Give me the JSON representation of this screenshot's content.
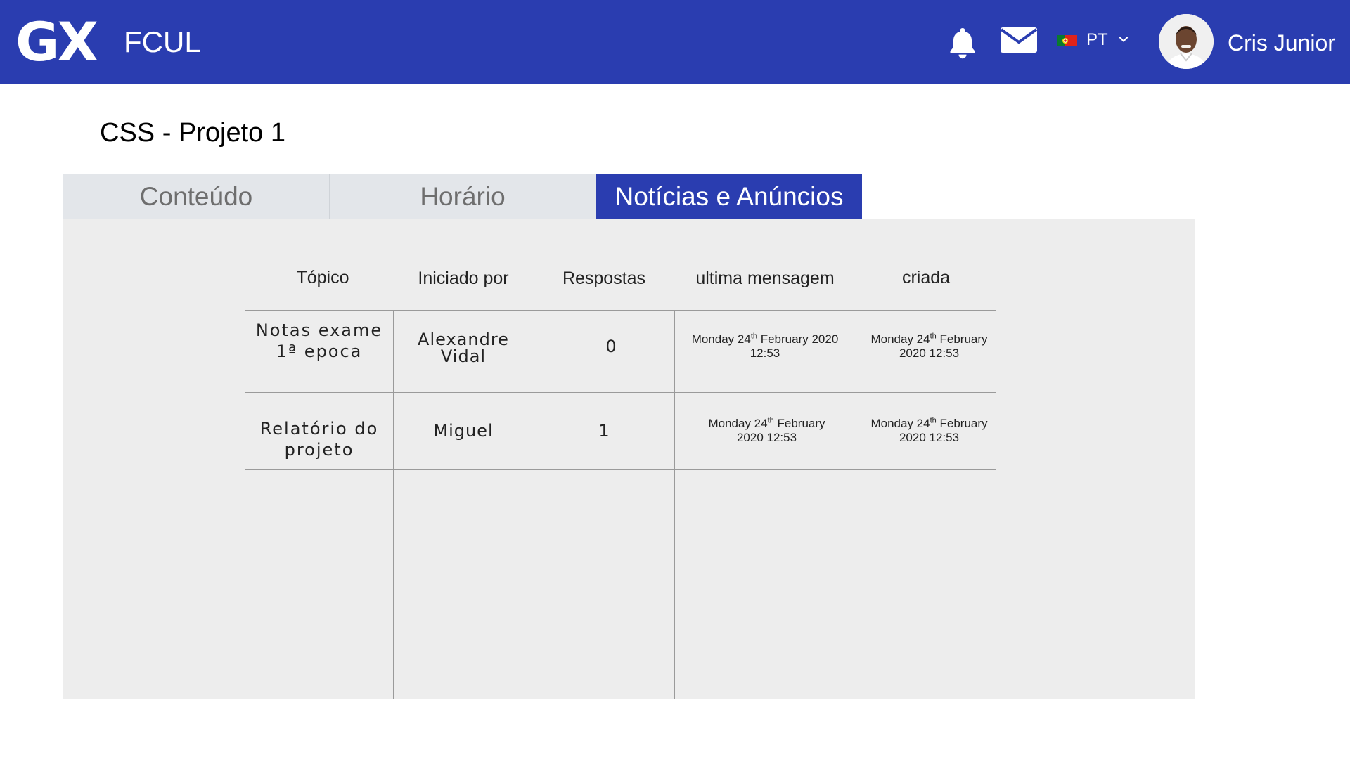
{
  "header": {
    "logo": "GX",
    "app_name": "FCUL",
    "language": "PT",
    "user_name": "Cris Junior",
    "bg_color": "#2a3db0"
  },
  "icons": {
    "bell": "bell-icon",
    "mail": "mail-icon",
    "flag": "portugal-flag-icon",
    "chevron": "chevron-down-icon",
    "avatar": "user-avatar"
  },
  "page": {
    "title": "CSS - Projeto 1"
  },
  "tabs": [
    {
      "label": "Conteúdo",
      "active": false
    },
    {
      "label": "Horário",
      "active": false
    },
    {
      "label": "Notícias e Anúncios",
      "active": true
    }
  ],
  "table": {
    "headers": [
      "Tópico",
      "Iniciado por",
      "Respostas",
      "ultima mensagem",
      "criada"
    ],
    "rows": [
      {
        "topic_line1": "Notas exame",
        "topic_line2": "1ª epoca",
        "author_line1": "Alexandre",
        "author_line2": "Vidal",
        "replies": "0",
        "last_day": "Monday 24",
        "last_suffix": "th",
        "last_rest1": " February 2020",
        "last_rest2": "12:53",
        "created_day": "Monday 24",
        "created_suffix": "th",
        "created_rest1": " February",
        "created_rest2": "2020 12:53"
      },
      {
        "topic_line1": "Relatório do",
        "topic_line2": "projeto",
        "author_line1": "Miguel",
        "replies": "1",
        "last_day": "Monday 24",
        "last_suffix": "th",
        "last_rest1": " February",
        "last_rest2": "2020 12:53",
        "created_day": "Monday 24",
        "created_suffix": "th",
        "created_rest1": " February",
        "created_rest2": "2020 12:53"
      }
    ]
  }
}
